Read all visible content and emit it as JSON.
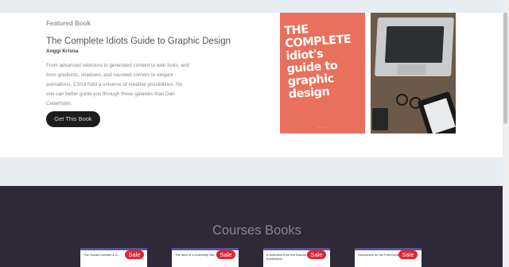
{
  "featured": {
    "eyebrow": "Featured Book",
    "title": "The Complete Idiots Guide to Graphic Design",
    "author": "Anggi Krisna",
    "description": "From advanced selectors to generated content to web fonts, and from gradients, shadows, and rounded corners to elegant animations, CSS3 hold a universe of creative possibilities. No one can better guide you through these galaxies than Dan Cederholm.",
    "cta_label": "Get This Book",
    "cover": {
      "title": "THE COMPLETE idiot's guide to graphic design",
      "color": "#e8705d"
    },
    "photo": {
      "icon": "laptop-desk-photo"
    }
  },
  "courses": {
    "heading": "Courses Books",
    "cards": [
      {
        "title": "The Social Contract & D...",
        "badge": "Sale"
      },
      {
        "title": "The Idea of a University Ski... Illustrated",
        "badge": "Sale"
      },
      {
        "title": "A Selection from the Discours... with the Enchiridion",
        "badge": "Sale"
      },
      {
        "title": "Discourses on the First Deca... Livius",
        "badge": "Sale"
      }
    ]
  },
  "colors": {
    "page_bg": "#e8edf1",
    "dark_section": "#2f2836",
    "sale_badge": "#e0252f",
    "button": "#1c1c1c"
  }
}
